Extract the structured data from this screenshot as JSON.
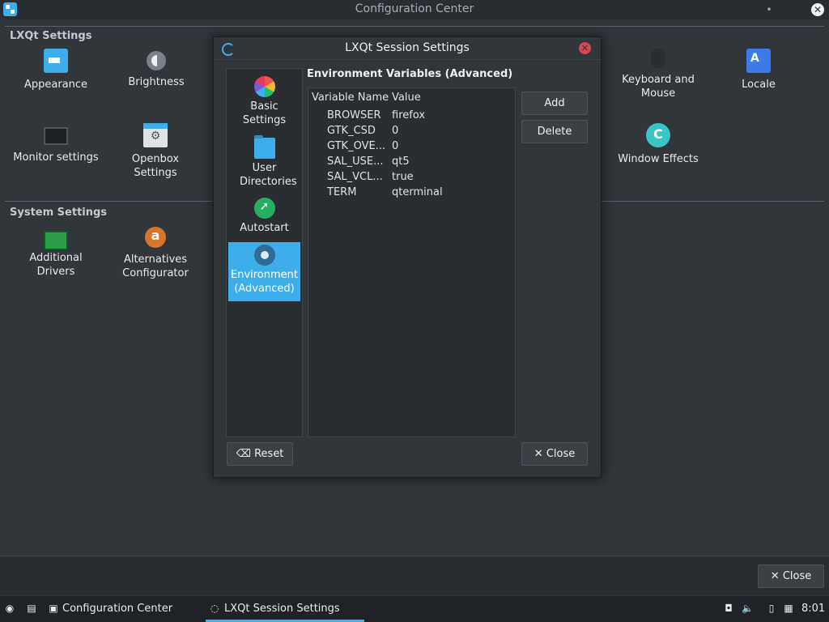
{
  "window": {
    "title": "Configuration Center",
    "controls": {
      "minimize": "•",
      "close": "✕"
    }
  },
  "lxqt_settings": {
    "title": "LXQt Settings",
    "items": [
      {
        "label": "Appearance",
        "icon": "appearance-icon"
      },
      {
        "label": "Brightness",
        "icon": "brightness-icon"
      },
      {
        "label": "Keyboard and Mouse",
        "icon": "keyboard-mouse-icon"
      },
      {
        "label": "Locale",
        "icon": "locale-icon"
      },
      {
        "label": "Monitor settings",
        "icon": "monitor-icon"
      },
      {
        "label": "Openbox Settings",
        "icon": "openbox-icon"
      },
      {
        "label": "Window Effects",
        "icon": "window-effects-icon"
      }
    ]
  },
  "system_settings": {
    "title": "System Settings",
    "items": [
      {
        "label": "Additional Drivers",
        "icon": "drivers-icon"
      },
      {
        "label": "Alternatives Configurator",
        "icon": "alternatives-icon"
      }
    ]
  },
  "dialog": {
    "title": "LXQt Session Settings",
    "sidebar": [
      {
        "label": "Basic Settings",
        "icon": "basic-settings-icon",
        "selected": false
      },
      {
        "label": "User Directories",
        "icon": "folder-icon",
        "selected": false
      },
      {
        "label": "Autostart",
        "icon": "rocket-icon",
        "selected": false
      },
      {
        "label": "Environment (Advanced)",
        "icon": "gear-icon",
        "selected": true
      }
    ],
    "heading": "Environment Variables (Advanced)",
    "columns": [
      "Variable Name",
      "Value"
    ],
    "rows": [
      {
        "name": "BROWSER",
        "value": "firefox"
      },
      {
        "name": "GTK_CSD",
        "value": "0"
      },
      {
        "name": "GTK_OVE...",
        "value": "0"
      },
      {
        "name": "SAL_USE...",
        "value": "qt5"
      },
      {
        "name": "SAL_VCL...",
        "value": "true"
      },
      {
        "name": "TERM",
        "value": "qterminal"
      }
    ],
    "buttons": {
      "add": "Add",
      "delete": "Delete",
      "reset": "Reset",
      "close": "Close"
    }
  },
  "main_buttons": {
    "close": "Close"
  },
  "taskbar": {
    "tasks": [
      {
        "label": "Configuration Center",
        "active": false
      },
      {
        "label": "LXQt Session Settings",
        "active": true
      }
    ],
    "clock": "8:01"
  },
  "colors": {
    "accent": "#3daee9",
    "background": "#31363b",
    "close_red": "#da4453"
  }
}
